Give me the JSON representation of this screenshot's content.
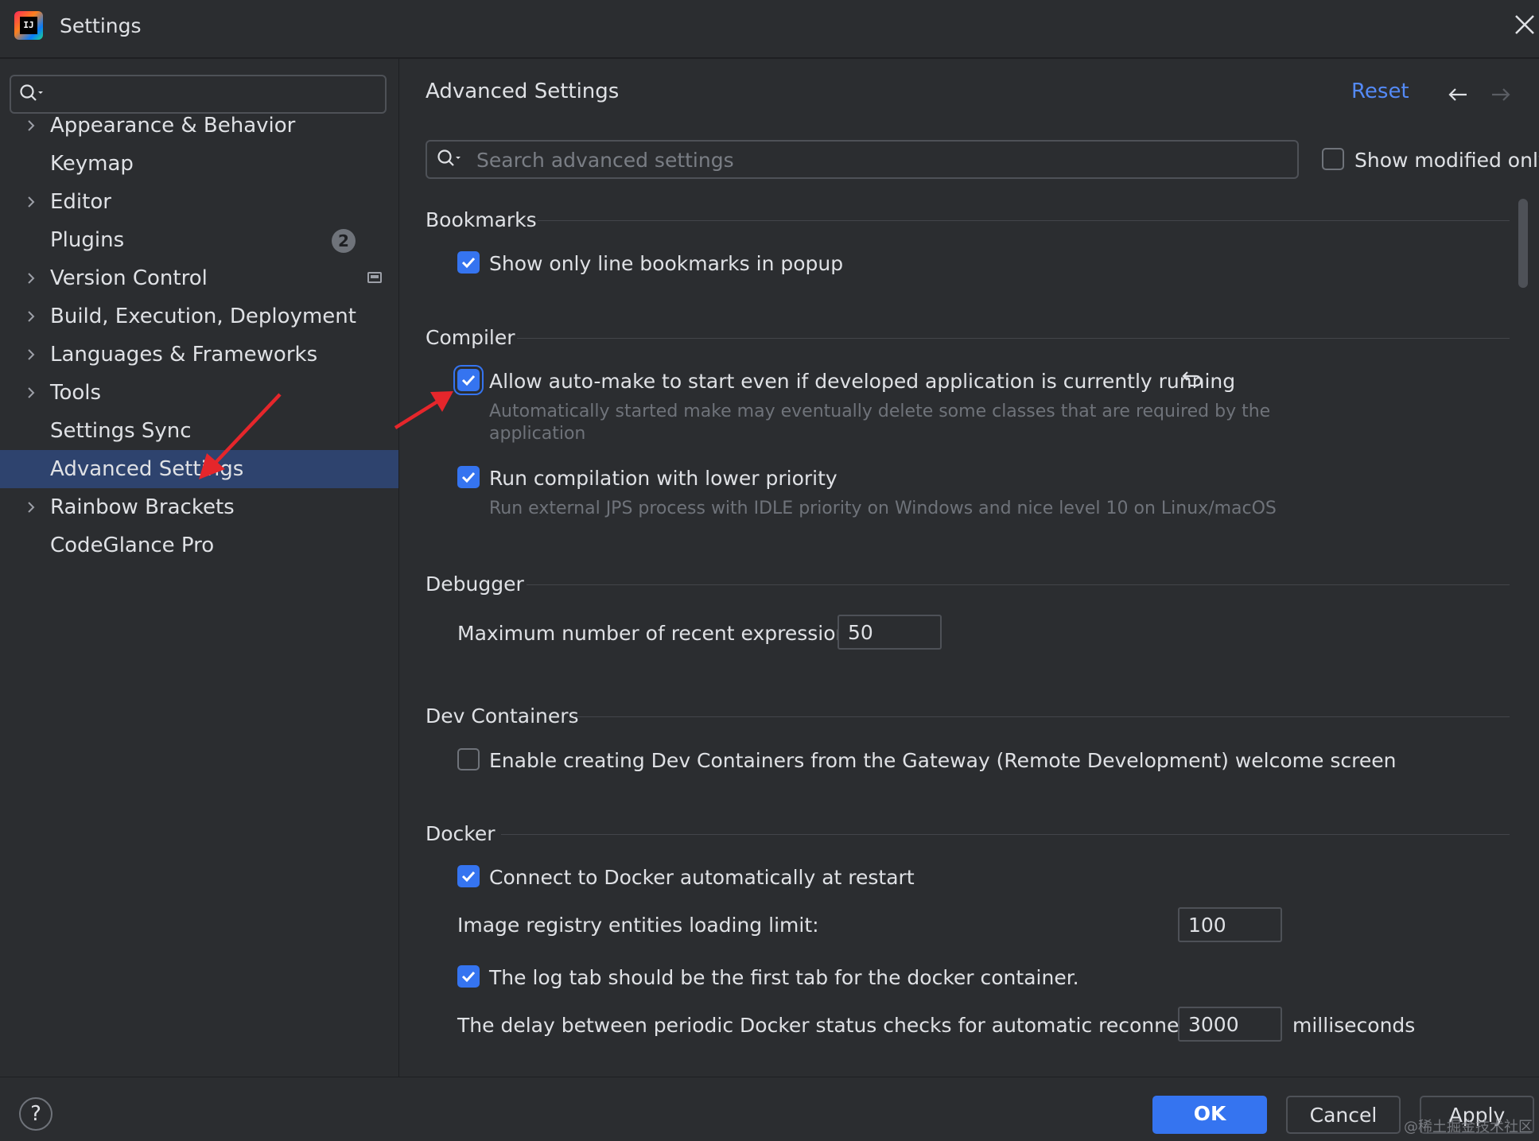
{
  "window": {
    "title": "Settings",
    "logo_text": "IJ"
  },
  "sidebar": {
    "items": [
      {
        "label": "Appearance & Behavior",
        "expandable": true
      },
      {
        "label": "Keymap",
        "expandable": false
      },
      {
        "label": "Editor",
        "expandable": true
      },
      {
        "label": "Plugins",
        "expandable": false,
        "badge": "2"
      },
      {
        "label": "Version Control",
        "expandable": true
      },
      {
        "label": "Build, Execution, Deployment",
        "expandable": true
      },
      {
        "label": "Languages & Frameworks",
        "expandable": true
      },
      {
        "label": "Tools",
        "expandable": true
      },
      {
        "label": "Settings Sync",
        "expandable": false
      },
      {
        "label": "Advanced Settings",
        "expandable": false,
        "selected": true
      },
      {
        "label": "Rainbow Brackets",
        "expandable": true
      },
      {
        "label": "CodeGlance Pro",
        "expandable": false
      }
    ]
  },
  "main": {
    "title": "Advanced Settings",
    "reset_label": "Reset",
    "search_placeholder": "Search advanced settings",
    "show_modified_label": "Show modified only",
    "sections": {
      "bookmarks": {
        "title": "Bookmarks",
        "popup_label": "Show only line bookmarks in popup"
      },
      "compiler": {
        "title": "Compiler",
        "automake_label": "Allow auto-make to start even if developed application is currently running",
        "automake_hint_1": "Automatically started make may eventually delete some classes that are required by the",
        "automake_hint_2": "application",
        "lowprio_label": "Run compilation with lower priority",
        "lowprio_hint": "Run external JPS process with IDLE priority on Windows and nice level 10 on Linux/macOS"
      },
      "debugger": {
        "title": "Debugger",
        "max_expr_label": "Maximum number of recent expressions:",
        "max_expr_value": "50"
      },
      "dev_containers": {
        "title": "Dev Containers",
        "gateway_label": "Enable creating Dev Containers from the Gateway (Remote Development) welcome screen"
      },
      "docker": {
        "title": "Docker",
        "auto_connect_label": "Connect to Docker automatically at restart",
        "registry_limit_label": "Image registry entities loading limit:",
        "registry_limit_value": "100",
        "log_tab_label": "The log tab should be the first tab for the docker container.",
        "delay_label": "The delay between periodic Docker status checks for automatic reconnection:",
        "delay_value": "3000",
        "delay_unit": "milliseconds"
      }
    }
  },
  "footer": {
    "help": "?",
    "ok": "OK",
    "cancel": "Cancel",
    "apply": "Apply"
  },
  "watermark": "@稀土掘金技术社区",
  "colors": {
    "accent": "#3574f0",
    "link": "#548af7",
    "background": "#2b2d30",
    "selection": "#2e436e",
    "annotation_arrow": "#e5262b"
  }
}
